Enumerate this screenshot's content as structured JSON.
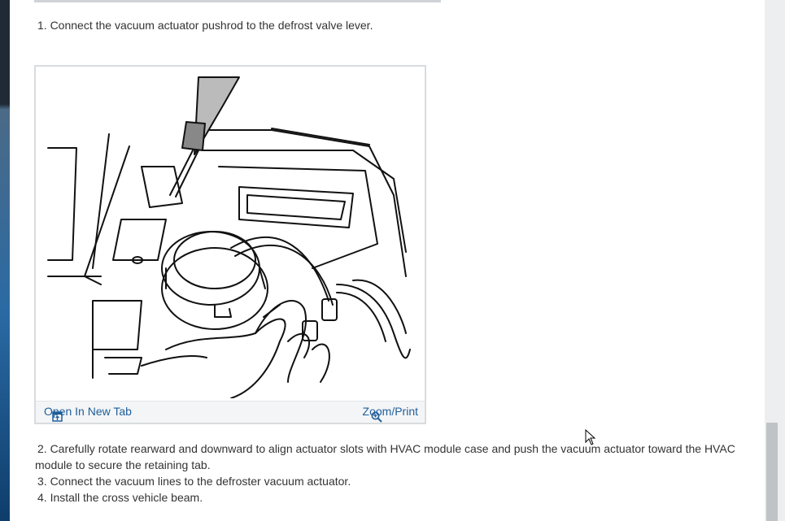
{
  "steps": {
    "step1": "1. Connect the vacuum actuator pushrod to the defrost valve lever.",
    "step2_line1": "2. Carefully rotate rearward and downward to align actuator slots with HVAC module case and push the vacuum actuator toward the HVAC",
    "step2_line2": "module to secure the retaining tab.",
    "step3": "3. Connect the vacuum lines to the defroster vacuum actuator.",
    "step4": "4. Install the cross vehicle beam."
  },
  "figure": {
    "open_new_tab_label": "Open In New Tab",
    "zoom_print_label": "Zoom/Print",
    "open_icon": "open-in-new-tab-icon",
    "zoom_icon": "zoom-icon"
  },
  "colors": {
    "link": "#1f5e9b",
    "text": "#333333"
  }
}
